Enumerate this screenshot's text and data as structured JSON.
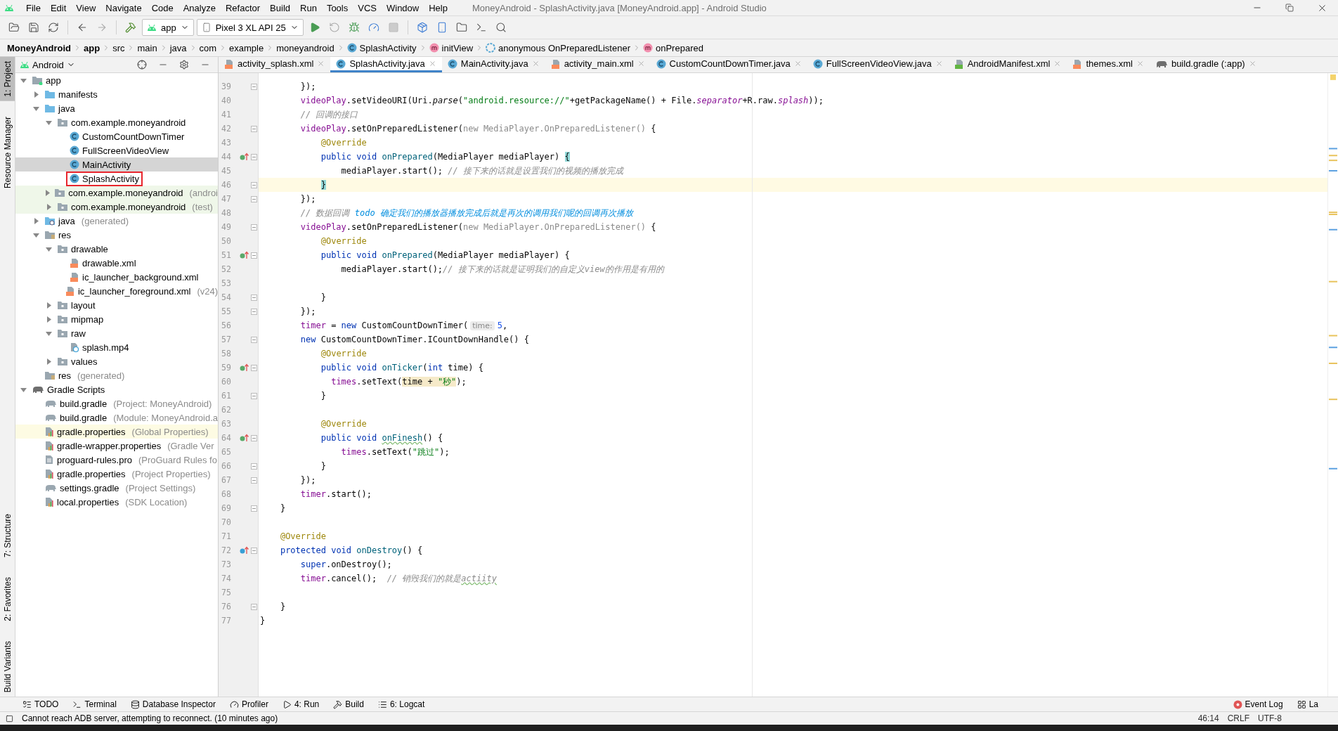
{
  "window": {
    "title": "MoneyAndroid - SplashActivity.java [MoneyAndroid.app] - Android Studio"
  },
  "menu": [
    "File",
    "Edit",
    "View",
    "Navigate",
    "Code",
    "Analyze",
    "Refactor",
    "Build",
    "Run",
    "Tools",
    "VCS",
    "Window",
    "Help"
  ],
  "toolbar": {
    "config": "app",
    "device": "Pixel 3 XL API 25"
  },
  "breadcrumbs": [
    {
      "label": "MoneyAndroid",
      "kind": "project"
    },
    {
      "label": "app",
      "kind": "module"
    },
    {
      "label": "src",
      "kind": "folder"
    },
    {
      "label": "main",
      "kind": "folder"
    },
    {
      "label": "java",
      "kind": "folder"
    },
    {
      "label": "com",
      "kind": "folder"
    },
    {
      "label": "example",
      "kind": "folder"
    },
    {
      "label": "moneyandroid",
      "kind": "folder"
    },
    {
      "label": "SplashActivity",
      "kind": "class"
    },
    {
      "label": "initView",
      "kind": "method"
    },
    {
      "label": "anonymous OnPreparedListener",
      "kind": "anonymous"
    },
    {
      "label": "onPrepared",
      "kind": "method"
    }
  ],
  "side_stripe": {
    "top": [
      "1: Project",
      "Resource Manager"
    ],
    "bottom": [
      "7: Structure",
      "2: Favorites",
      "Build Variants"
    ]
  },
  "project_panel": {
    "view": "Android",
    "tree": [
      {
        "label": "app",
        "kind": "module",
        "expanded": true,
        "selected": false,
        "boxed": false,
        "children": [
          {
            "label": "manifests",
            "kind": "folder",
            "expanded": false,
            "selected": false,
            "boxed": false
          },
          {
            "label": "java",
            "kind": "folder",
            "expanded": true,
            "selected": false,
            "boxed": false,
            "children": [
              {
                "label": "com.example.moneyandroid",
                "kind": "package",
                "expanded": true,
                "selected": false,
                "boxed": false,
                "children": [
                  {
                    "label": "CustomCountDownTimer",
                    "kind": "class",
                    "selected": false,
                    "boxed": false
                  },
                  {
                    "label": "FullScreenVideoView",
                    "kind": "class",
                    "selected": false,
                    "boxed": false
                  },
                  {
                    "label": "MainActivity",
                    "kind": "class",
                    "selected": true,
                    "boxed": false
                  },
                  {
                    "label": "SplashActivity",
                    "kind": "class",
                    "selected": false,
                    "boxed": true
                  }
                ]
              },
              {
                "label": "com.example.moneyandroid",
                "note": "(androi",
                "kind": "package",
                "expanded": false,
                "selected": false,
                "boxed": false,
                "color": "#eff7e9"
              },
              {
                "label": "com.example.moneyandroid",
                "note": "(test)",
                "kind": "package",
                "expanded": false,
                "selected": false,
                "boxed": false,
                "color": "#eff7e9"
              }
            ]
          },
          {
            "label": "java",
            "note": "(generated)",
            "kind": "generated",
            "expanded": false,
            "selected": false,
            "boxed": false
          },
          {
            "label": "res",
            "kind": "res",
            "expanded": true,
            "selected": false,
            "boxed": false,
            "children": [
              {
                "label": "drawable",
                "kind": "package",
                "expanded": true,
                "selected": false,
                "boxed": false,
                "children": [
                  {
                    "label": "drawable.xml",
                    "kind": "xml",
                    "selected": false,
                    "boxed": false
                  },
                  {
                    "label": "ic_launcher_background.xml",
                    "kind": "xml",
                    "selected": false,
                    "boxed": false
                  },
                  {
                    "label": "ic_launcher_foreground.xml",
                    "note": "(v24)",
                    "kind": "xml",
                    "selected": false,
                    "boxed": false
                  }
                ]
              },
              {
                "label": "layout",
                "kind": "package",
                "expanded": false,
                "selected": false,
                "boxed": false
              },
              {
                "label": "mipmap",
                "kind": "package",
                "expanded": false,
                "selected": false,
                "boxed": false
              },
              {
                "label": "raw",
                "kind": "package",
                "expanded": true,
                "selected": false,
                "boxed": false,
                "children": [
                  {
                    "label": "splash.mp4",
                    "kind": "video",
                    "selected": false,
                    "boxed": false
                  }
                ]
              },
              {
                "label": "values",
                "kind": "package",
                "expanded": false,
                "selected": false,
                "boxed": false
              }
            ]
          },
          {
            "label": "res",
            "note": "(generated)",
            "kind": "res",
            "selected": false,
            "boxed": false
          }
        ]
      },
      {
        "label": "Gradle Scripts",
        "kind": "gradle",
        "expanded": true,
        "selected": false,
        "boxed": false,
        "children": [
          {
            "label": "build.gradle",
            "note": "(Project: MoneyAndroid)",
            "kind": "gradle-file",
            "selected": false,
            "boxed": false
          },
          {
            "label": "build.gradle",
            "note": "(Module: MoneyAndroid.a",
            "kind": "gradle-file",
            "selected": false,
            "boxed": false
          },
          {
            "label": "gradle.properties",
            "note": "(Global Properties)",
            "kind": "properties",
            "selected": false,
            "boxed": false,
            "color": "#fdfbe3"
          },
          {
            "label": "gradle-wrapper.properties",
            "note": "(Gradle Ver",
            "kind": "properties",
            "selected": false,
            "boxed": false
          },
          {
            "label": "proguard-rules.pro",
            "note": "(ProGuard Rules fo",
            "kind": "text",
            "selected": false,
            "boxed": false
          },
          {
            "label": "gradle.properties",
            "note": "(Project Properties)",
            "kind": "properties",
            "selected": false,
            "boxed": false
          },
          {
            "label": "settings.gradle",
            "note": "(Project Settings)",
            "kind": "gradle-file",
            "selected": false,
            "boxed": false
          },
          {
            "label": "local.properties",
            "note": "(SDK Location)",
            "kind": "properties",
            "selected": false,
            "boxed": false
          }
        ]
      }
    ]
  },
  "tabs": [
    {
      "label": "activity_splash.xml",
      "kind": "xml",
      "selected": false
    },
    {
      "label": "SplashActivity.java",
      "kind": "class",
      "selected": true
    },
    {
      "label": "MainActivity.java",
      "kind": "class",
      "selected": false
    },
    {
      "label": "activity_main.xml",
      "kind": "xml",
      "selected": false
    },
    {
      "label": "CustomCountDownTimer.java",
      "kind": "class",
      "selected": false
    },
    {
      "label": "FullScreenVideoView.java",
      "kind": "class",
      "selected": false
    },
    {
      "label": "AndroidManifest.xml",
      "kind": "manifest",
      "selected": false
    },
    {
      "label": "themes.xml",
      "kind": "xml",
      "selected": false
    },
    {
      "label": "build.gradle (:app)",
      "kind": "gradle",
      "selected": false
    }
  ],
  "editor": {
    "lines": [
      {
        "no": "39",
        "kind": "code",
        "fold": true,
        "current": false,
        "tokens": [
          {
            "kind": "plain",
            "text": "        });"
          }
        ]
      },
      {
        "no": "40",
        "kind": "code",
        "fold": false,
        "current": false,
        "tokens": [
          {
            "kind": "field",
            "text": "        videoPlay"
          },
          {
            "kind": "plain",
            "text": ".setVideoURI(Uri."
          },
          {
            "kind": "static",
            "text": "parse"
          },
          {
            "kind": "plain",
            "text": "("
          },
          {
            "kind": "string",
            "text": "\"android.resource://\""
          },
          {
            "kind": "plain",
            "text": "+getPackageName() + File."
          },
          {
            "kind": "static-field",
            "text": "separator"
          },
          {
            "kind": "plain",
            "text": "+R.raw."
          },
          {
            "kind": "static-field",
            "text": "splash"
          },
          {
            "kind": "plain",
            "text": "));"
          }
        ]
      },
      {
        "no": "41",
        "kind": "code",
        "fold": false,
        "current": false,
        "tokens": [
          {
            "kind": "comment",
            "text": "        // 回调的接口"
          }
        ]
      },
      {
        "no": "42",
        "kind": "code",
        "fold": true,
        "current": false,
        "tokens": [
          {
            "kind": "field",
            "text": "        videoPlay"
          },
          {
            "kind": "plain",
            "text": ".setOnPreparedListener("
          },
          {
            "kind": "dim",
            "text": "new MediaPlayer.OnPreparedListener()"
          },
          {
            "kind": "plain",
            "text": " {"
          }
        ]
      },
      {
        "no": "43",
        "kind": "code",
        "fold": false,
        "current": false,
        "tokens": [
          {
            "kind": "annotation",
            "text": "            @Override"
          }
        ]
      },
      {
        "no": "44",
        "kind": "implements",
        "fold": true,
        "current": false,
        "tokens": [
          {
            "kind": "keyword",
            "text": "            public void "
          },
          {
            "kind": "decl",
            "text": "onPrepared"
          },
          {
            "kind": "plain",
            "text": "(MediaPlayer mediaPlayer) "
          },
          {
            "kind": "match",
            "text": "{"
          }
        ]
      },
      {
        "no": "45",
        "kind": "code",
        "fold": false,
        "current": false,
        "tokens": [
          {
            "kind": "plain",
            "text": "                mediaPlayer.start(); "
          },
          {
            "kind": "comment",
            "text": "// 接下来的话就是设置我们的视频的播放完成"
          }
        ]
      },
      {
        "no": "46",
        "kind": "code",
        "fold": true,
        "current": true,
        "tokens": [
          {
            "kind": "match",
            "text": "            }"
          }
        ]
      },
      {
        "no": "47",
        "kind": "code",
        "fold": true,
        "current": false,
        "tokens": [
          {
            "kind": "plain",
            "text": "        });"
          }
        ]
      },
      {
        "no": "48",
        "kind": "code",
        "fold": false,
        "current": false,
        "tokens": [
          {
            "kind": "comment",
            "text": "        // 数据回调 "
          },
          {
            "kind": "todo",
            "text": "todo 确定我们的播放器播放完成后就是再次的调用我们呢的回调再次播放"
          }
        ]
      },
      {
        "no": "49",
        "kind": "code",
        "fold": true,
        "current": false,
        "tokens": [
          {
            "kind": "field",
            "text": "        videoPlay"
          },
          {
            "kind": "plain",
            "text": ".setOnPreparedListener("
          },
          {
            "kind": "dim",
            "text": "new MediaPlayer.OnPreparedListener()"
          },
          {
            "kind": "plain",
            "text": " {"
          }
        ]
      },
      {
        "no": "50",
        "kind": "code",
        "fold": false,
        "current": false,
        "tokens": [
          {
            "kind": "annotation",
            "text": "            @Override"
          }
        ]
      },
      {
        "no": "51",
        "kind": "implements",
        "fold": true,
        "current": false,
        "tokens": [
          {
            "kind": "keyword",
            "text": "            public void "
          },
          {
            "kind": "decl",
            "text": "onPrepared"
          },
          {
            "kind": "plain",
            "text": "(MediaPlayer mediaPlayer) {"
          }
        ]
      },
      {
        "no": "52",
        "kind": "code",
        "fold": false,
        "current": false,
        "tokens": [
          {
            "kind": "plain",
            "text": "                mediaPlayer.start();"
          },
          {
            "kind": "comment",
            "text": "// 接下来的话就是证明我们的自定义view的作用是有用的"
          }
        ]
      },
      {
        "no": "53",
        "kind": "code",
        "fold": false,
        "current": false
      },
      {
        "no": "54",
        "kind": "code",
        "fold": true,
        "current": false,
        "tokens": [
          {
            "kind": "plain",
            "text": "            }"
          }
        ]
      },
      {
        "no": "55",
        "kind": "code",
        "fold": true,
        "current": false,
        "tokens": [
          {
            "kind": "plain",
            "text": "        });"
          }
        ]
      },
      {
        "no": "56",
        "kind": "code",
        "fold": false,
        "current": false,
        "tokens": [
          {
            "kind": "field",
            "text": "        timer"
          },
          {
            "kind": "plain",
            "text": " = "
          },
          {
            "kind": "keyword",
            "text": "new"
          },
          {
            "kind": "plain",
            "text": " CustomCountDownTimer("
          },
          {
            "kind": "hint",
            "text": "time:"
          },
          {
            "kind": "number",
            "text": "5"
          },
          {
            "kind": "plain",
            "text": ","
          }
        ]
      },
      {
        "no": "57",
        "kind": "code",
        "fold": true,
        "current": false,
        "tokens": [
          {
            "kind": "keyword",
            "text": "        new"
          },
          {
            "kind": "plain",
            "text": " CustomCountDownTimer.ICountDownHandle() {"
          }
        ]
      },
      {
        "no": "58",
        "kind": "code",
        "fold": false,
        "current": false,
        "tokens": [
          {
            "kind": "annotation",
            "text": "            @Override"
          }
        ]
      },
      {
        "no": "59",
        "kind": "implements",
        "fold": true,
        "current": false,
        "tokens": [
          {
            "kind": "keyword",
            "text": "            public void "
          },
          {
            "kind": "decl",
            "text": "onTicker"
          },
          {
            "kind": "plain",
            "text": "("
          },
          {
            "kind": "keyword",
            "text": "int"
          },
          {
            "kind": "plain",
            "text": " time) {"
          }
        ]
      },
      {
        "no": "60",
        "kind": "code",
        "fold": false,
        "current": false,
        "tokens": [
          {
            "kind": "field",
            "text": "              times"
          },
          {
            "kind": "plain",
            "text": ".setText("
          },
          {
            "kind": "usage",
            "text": "time + "
          },
          {
            "kind": "usage-string",
            "text": "\"秒\""
          },
          {
            "kind": "plain",
            "text": ");"
          }
        ]
      },
      {
        "no": "61",
        "kind": "code",
        "fold": true,
        "current": false,
        "tokens": [
          {
            "kind": "plain",
            "text": "            }"
          }
        ]
      },
      {
        "no": "62",
        "kind": "code",
        "fold": false,
        "current": false
      },
      {
        "no": "63",
        "kind": "code",
        "fold": false,
        "current": false,
        "tokens": [
          {
            "kind": "annotation",
            "text": "            @Override"
          }
        ]
      },
      {
        "no": "64",
        "kind": "implements",
        "fold": true,
        "current": false,
        "tokens": [
          {
            "kind": "keyword",
            "text": "            public void "
          },
          {
            "kind": "decl-typo",
            "text": "onFinesh"
          },
          {
            "kind": "plain",
            "text": "() {"
          }
        ]
      },
      {
        "no": "65",
        "kind": "code",
        "fold": false,
        "current": false,
        "tokens": [
          {
            "kind": "field",
            "text": "                times"
          },
          {
            "kind": "plain",
            "text": ".setText("
          },
          {
            "kind": "string",
            "text": "\"跳过\""
          },
          {
            "kind": "plain",
            "text": ");"
          }
        ]
      },
      {
        "no": "66",
        "kind": "code",
        "fold": true,
        "current": false,
        "tokens": [
          {
            "kind": "plain",
            "text": "            }"
          }
        ]
      },
      {
        "no": "67",
        "kind": "code",
        "fold": true,
        "current": false,
        "tokens": [
          {
            "kind": "plain",
            "text": "        });"
          }
        ]
      },
      {
        "no": "68",
        "kind": "code",
        "fold": false,
        "current": false,
        "tokens": [
          {
            "kind": "field",
            "text": "        timer"
          },
          {
            "kind": "plain",
            "text": ".start();"
          }
        ]
      },
      {
        "no": "69",
        "kind": "code",
        "fold": true,
        "current": false,
        "tokens": [
          {
            "kind": "plain",
            "text": "    }"
          }
        ]
      },
      {
        "no": "70",
        "kind": "code",
        "fold": false,
        "current": false
      },
      {
        "no": "71",
        "kind": "code",
        "fold": false,
        "current": false,
        "tokens": [
          {
            "kind": "annotation",
            "text": "    @Override"
          }
        ]
      },
      {
        "no": "72",
        "kind": "overrides",
        "fold": true,
        "current": false,
        "tokens": [
          {
            "kind": "keyword",
            "text": "    protected void "
          },
          {
            "kind": "decl",
            "text": "onDestroy"
          },
          {
            "kind": "plain",
            "text": "() {"
          }
        ]
      },
      {
        "no": "73",
        "kind": "code",
        "fold": false,
        "current": false,
        "tokens": [
          {
            "kind": "keyword",
            "text": "        super"
          },
          {
            "kind": "plain",
            "text": ".onDestroy();"
          }
        ]
      },
      {
        "no": "74",
        "kind": "code",
        "fold": false,
        "current": false,
        "tokens": [
          {
            "kind": "field",
            "text": "        timer"
          },
          {
            "kind": "plain",
            "text": ".cancel();  "
          },
          {
            "kind": "comment",
            "text": "// 销毁我们的就是"
          },
          {
            "kind": "comment-typo",
            "text": "actiity"
          }
        ]
      },
      {
        "no": "75",
        "kind": "code",
        "fold": false,
        "current": false
      },
      {
        "no": "76",
        "kind": "code",
        "fold": true,
        "current": false,
        "tokens": [
          {
            "kind": "plain",
            "text": "    }"
          }
        ]
      },
      {
        "no": "77",
        "kind": "code",
        "fold": false,
        "current": false,
        "tokens": [
          {
            "kind": "plain",
            "text": "}"
          }
        ]
      }
    ]
  },
  "tool_windows": {
    "left": [
      {
        "label": "TODO",
        "kind": "todo"
      },
      {
        "label": "Terminal",
        "kind": "terminal"
      },
      {
        "label": "Database Inspector",
        "kind": "database"
      },
      {
        "label": "Profiler",
        "kind": "profiler"
      },
      {
        "label": "4: Run",
        "kind": "run"
      },
      {
        "label": "Build",
        "kind": "build"
      },
      {
        "label": "6: Logcat",
        "kind": "logcat"
      }
    ],
    "right": [
      {
        "label": "Event Log",
        "kind": "event"
      },
      {
        "label": "La",
        "kind": "layout"
      }
    ]
  },
  "status_bar": {
    "message": "Cannot reach ADB server, attempting to reconnect. (10 minutes ago)",
    "position": "46:14",
    "line_separator": "CRLF",
    "encoding": "UTF-8"
  }
}
